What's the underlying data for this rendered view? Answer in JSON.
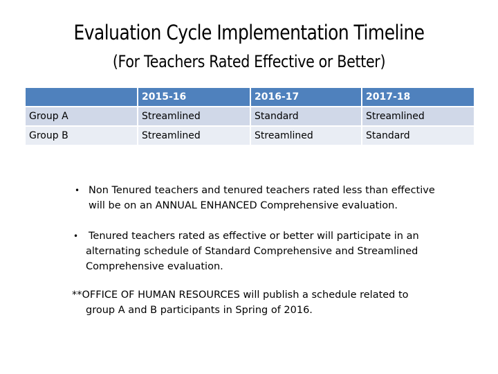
{
  "slide": {
    "title": "Evaluation Cycle Implementation Timeline",
    "subtitle": "(For Teachers Rated Effective or Better)"
  },
  "table": {
    "header": [
      "",
      "2015-16",
      "2016-17",
      "2017-18"
    ],
    "rows": [
      [
        "Group A",
        "Streamlined",
        "Standard",
        "Streamlined"
      ],
      [
        "Group B",
        "Streamlined",
        "Streamlined",
        "Standard"
      ]
    ],
    "colors": {
      "header_bg": "#4f81bd",
      "row_odd_bg": "#d0d8e8",
      "row_even_bg": "#e9edf4"
    }
  },
  "bullets": [
    {
      "marker": "•",
      "line1": "Non Tenured teachers and tenured teachers rated less than effective",
      "line2": "will be on an ANNUAL ENHANCED Comprehensive evaluation."
    },
    {
      "marker": "•",
      "line1": "Tenured teachers rated as effective or better will participate in an",
      "line2": "alternating schedule of Standard Comprehensive and Streamlined",
      "line3": "Comprehensive evaluation."
    }
  ],
  "note": {
    "line1": "**OFFICE OF HUMAN RESOURCES will publish a schedule related to",
    "line2": "group A and B participants in Spring of 2016."
  }
}
